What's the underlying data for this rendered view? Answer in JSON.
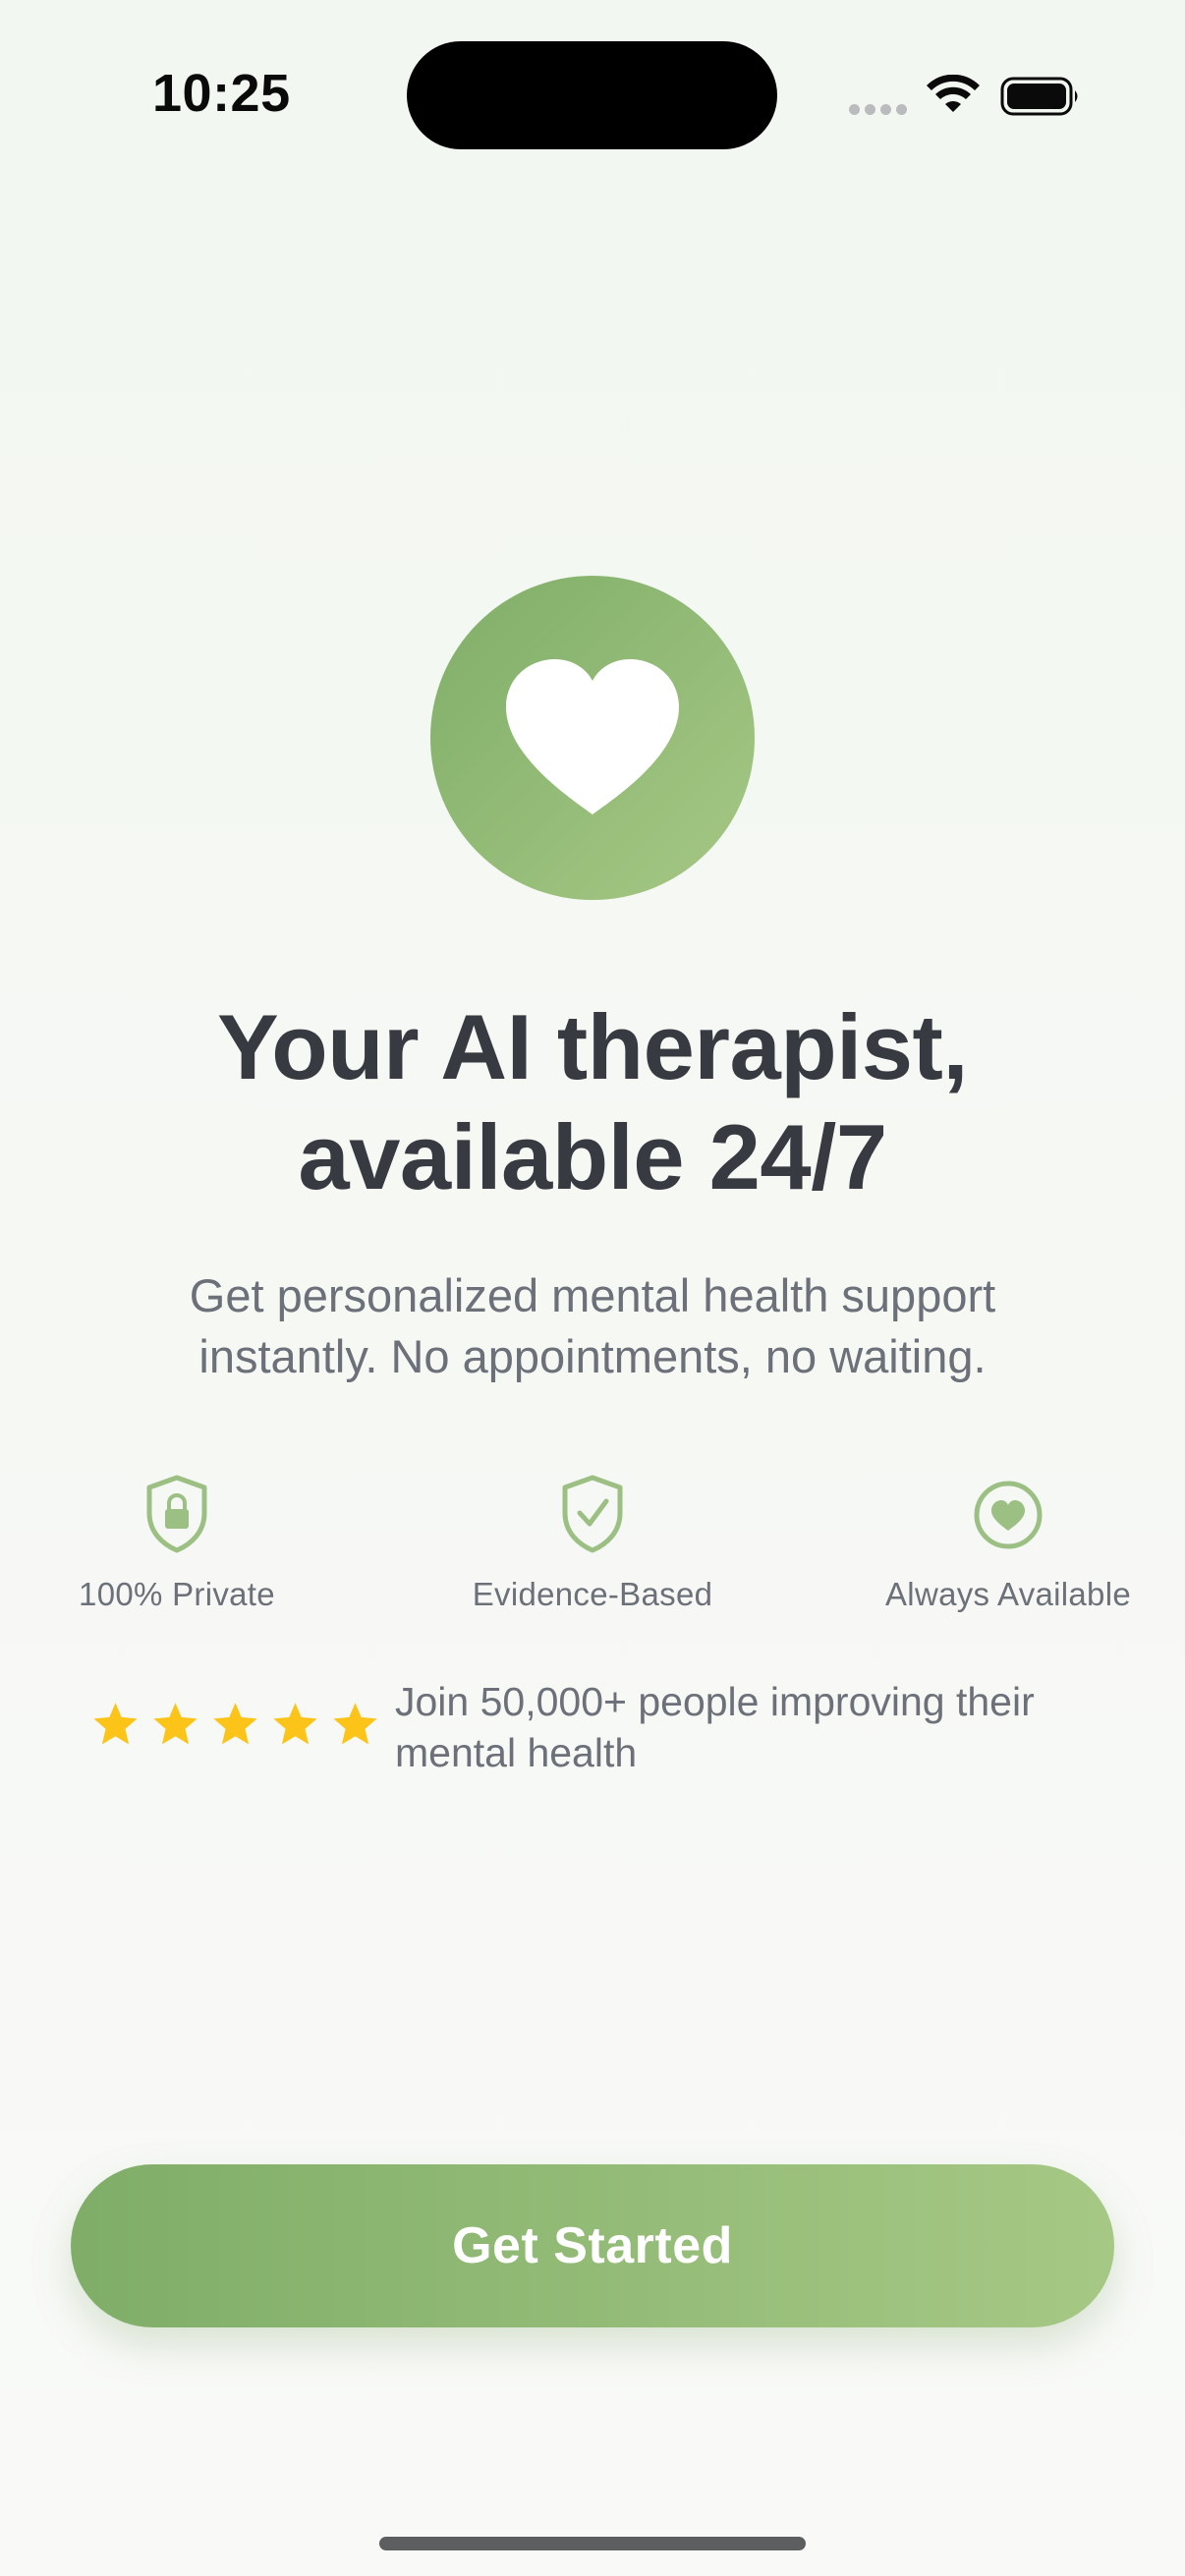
{
  "status_bar": {
    "time": "10:25",
    "icons": [
      "cellular-signal-icon",
      "wifi-icon",
      "battery-icon"
    ]
  },
  "hero": {
    "icon": "heart-icon",
    "headline_line1": "Your AI therapist,",
    "headline_line2": "available 24/7",
    "subtitle_line1": "Get personalized mental health support",
    "subtitle_line2": "instantly. No appointments, no waiting."
  },
  "features": [
    {
      "icon": "lock-shield-icon",
      "label": "100% Private"
    },
    {
      "icon": "check-shield-icon",
      "label": "Evidence-Based"
    },
    {
      "icon": "heart-circle-icon",
      "label": "Always Available"
    }
  ],
  "rating": {
    "stars": 5,
    "text_line1": "Join 50,000+ people improving their",
    "text_line2": "mental health"
  },
  "cta": {
    "label": "Get Started"
  },
  "colors": {
    "accent_start": "#7fae68",
    "accent_end": "#a6c885",
    "icon_green": "#9cc083",
    "star": "#fcc419",
    "headline": "#373a41",
    "body_text": "#6c7078"
  }
}
